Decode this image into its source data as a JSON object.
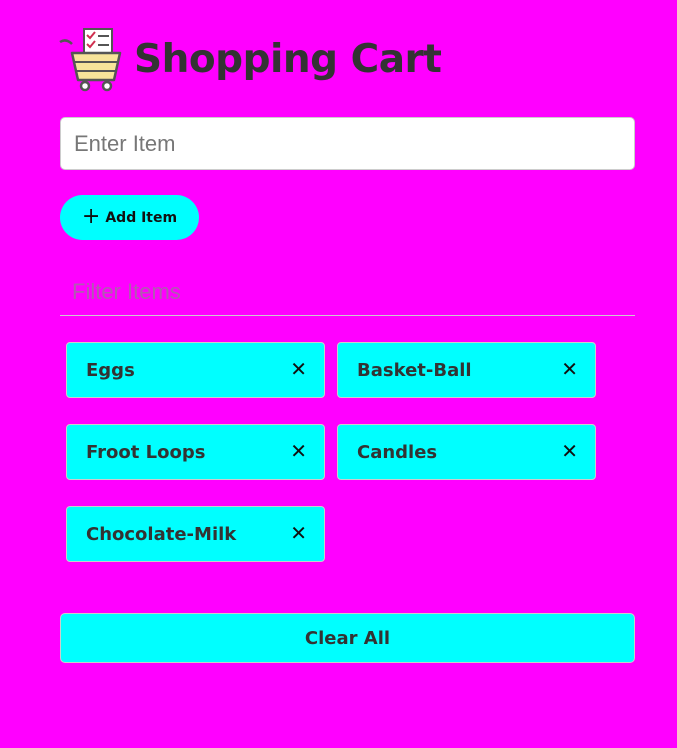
{
  "header": {
    "title": "Shopping Cart",
    "logo_icon": "shopping-cart-checklist-icon"
  },
  "form": {
    "item_input_placeholder": "Enter Item",
    "add_button_icon": "plus-icon",
    "add_button_label": "Add Item"
  },
  "filter": {
    "placeholder": "Filter Items"
  },
  "items": [
    {
      "label": "Eggs",
      "remove_icon": "close-icon"
    },
    {
      "label": "Basket-Ball",
      "remove_icon": "close-icon"
    },
    {
      "label": "Froot Loops",
      "remove_icon": "close-icon"
    },
    {
      "label": "Candles",
      "remove_icon": "close-icon"
    },
    {
      "label": "Chocolate-Milk",
      "remove_icon": "close-icon"
    }
  ],
  "clear_button_label": "Clear All",
  "colors": {
    "background": "#ff00ff",
    "accent": "#00ffff",
    "text": "#333333"
  }
}
